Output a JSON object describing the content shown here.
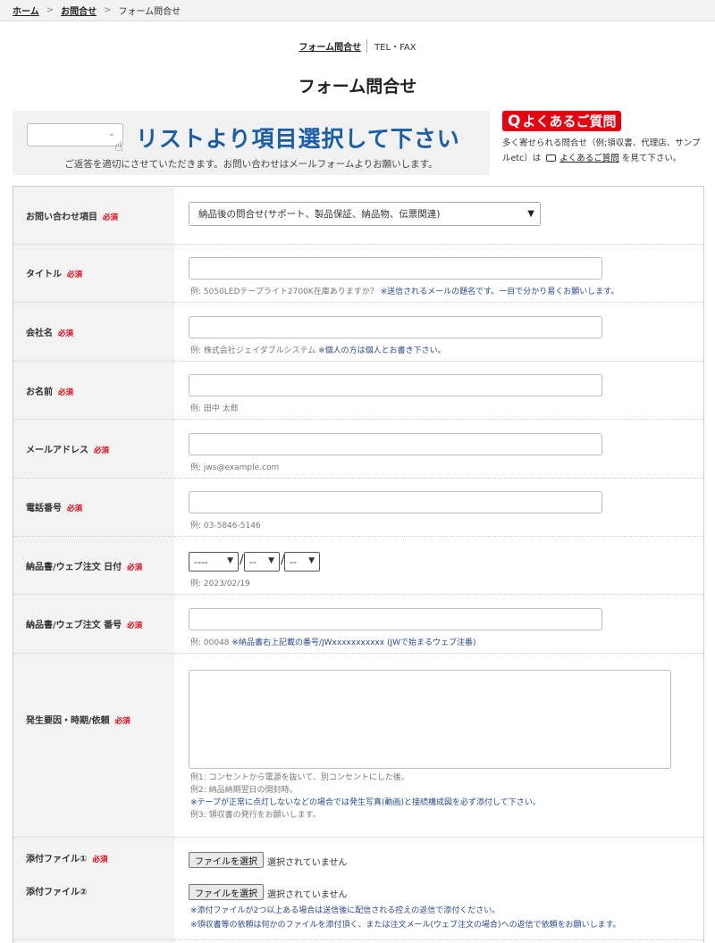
{
  "breadcrumb": {
    "home": "ホーム",
    "sep": ">",
    "contact": "お問合せ",
    "current": "フォーム問合せ"
  },
  "subnav": {
    "form": "フォーム問合せ",
    "tel": "TEL・FAX"
  },
  "page_title": "フォーム問合せ",
  "banner": {
    "headline": "リストより項目選択して下さい",
    "note": "ご返答を適切にさせていただきます。お問い合わせはメールフォームよりお願いします。"
  },
  "faq": {
    "button_q": "Q",
    "button_label": "よくあるご質問",
    "text_before": "多く寄せられる問合せ（例;領収書、代理店、サンプルetc）は",
    "link": "よくあるご質問",
    "text_after": "を見て下さい。"
  },
  "required_mark": "必須",
  "fields": {
    "inquiry_type": {
      "label": "お問い合わせ項目",
      "value": "納品後の問合せ(サポート、製品保証、納品物、伝票関連)"
    },
    "title": {
      "label": "タイトル",
      "hint": "例: 5050LEDテープライト2700K在庫ありますか？",
      "hint_blue": "※送信されるメールの題名です。一目で分かり易くお願いします。"
    },
    "company": {
      "label": "会社名",
      "hint": "例: 株式会社ジェイダブルシステム",
      "hint_blue": "※個人の方は個人とお書き下さい。"
    },
    "name": {
      "label": "お名前",
      "hint": "例: 田中 太郎"
    },
    "email": {
      "label": "メールアドレス",
      "hint": "例: jws@example.com"
    },
    "phone": {
      "label": "電話番号",
      "hint": "例: 03-5846-5146"
    },
    "order_date": {
      "label": "納品書/ウェブ注文 日付",
      "year": "----",
      "month": "--",
      "day": "--",
      "hint": "例: 2023/02/19"
    },
    "order_number": {
      "label": "納品書/ウェブ注文 番号",
      "hint": "例: 00048",
      "hint_blue": "※納品書右上記載の番号/JWxxxxxxxxxxx (JWで始まるウェブ注番)"
    },
    "details": {
      "label": "発生要因・時期/依頼",
      "hint1": "例1: コンセントから電源を抜いて、別コンセントにした後。",
      "hint2": "例2: 納品納期翌日の開封時。",
      "hint3": "※テープが正常に点灯しないなどの場合では発生写真(動画)と接続構成図を必ず添付して下さい。",
      "hint4": "例3: 領収書の発行をお願いします。"
    },
    "attachment1": {
      "label": "添付ファイル①",
      "button": "ファイルを選択",
      "status": "選択されていません"
    },
    "attachment2": {
      "label": "添付ファイル②",
      "button": "ファイルを選択",
      "status": "選択されていません"
    },
    "attachment_notes": {
      "note1": "※添付ファイルが2つ以上ある場合は送信後に配信される控えの返信で添付ください。",
      "note2": "※領収書等の依頼は何かのファイルを添付頂く、または注文メール(ウェブ注文の場合)への返信で依頼をお願いします。"
    }
  }
}
